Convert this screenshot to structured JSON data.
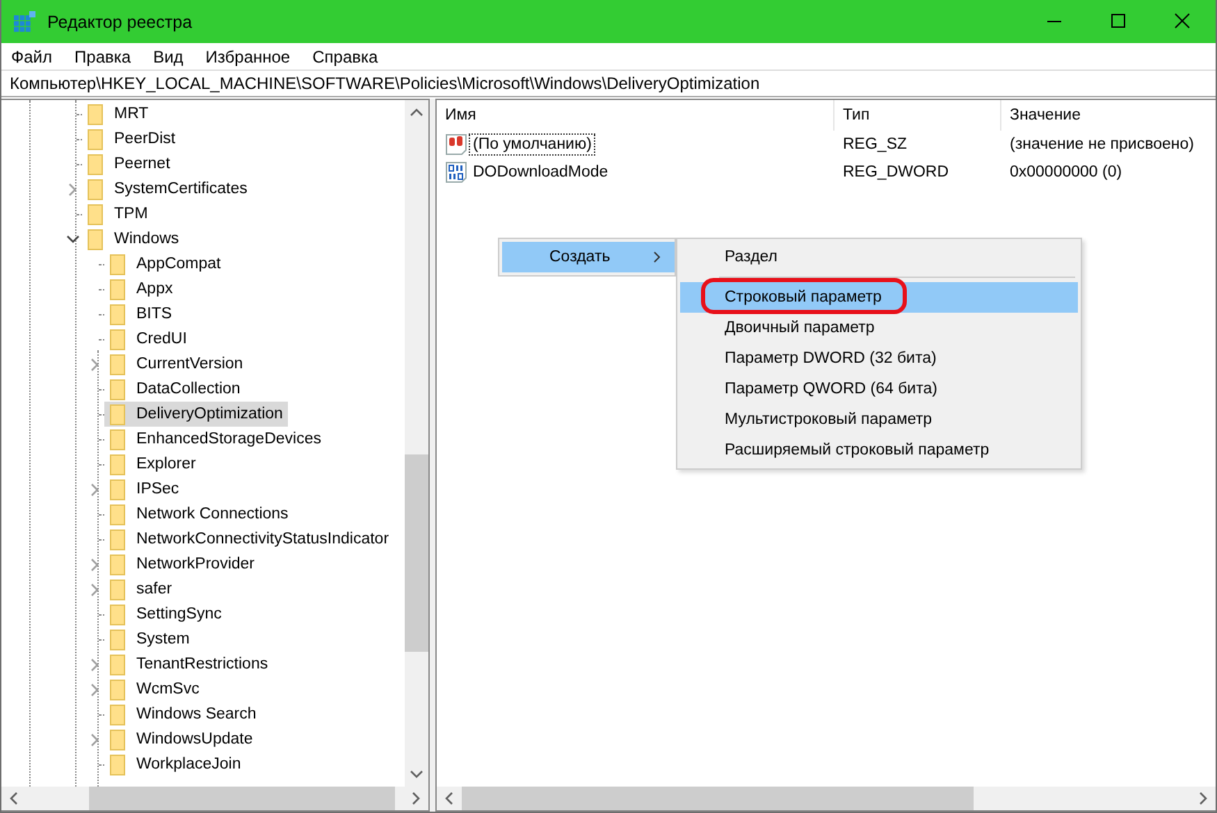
{
  "window": {
    "title": "Редактор реестра"
  },
  "menu": [
    "Файл",
    "Правка",
    "Вид",
    "Избранное",
    "Справка"
  ],
  "address": "Компьютер\\HKEY_LOCAL_MACHINE\\SOFTWARE\\Policies\\Microsoft\\Windows\\DeliveryOptimization",
  "tree": [
    {
      "label": "MRT",
      "kind": "leaf",
      "selected": false
    },
    {
      "label": "PeerDist",
      "kind": "leaf",
      "selected": false
    },
    {
      "label": "Peernet",
      "kind": "leaf",
      "selected": false
    },
    {
      "label": "SystemCertificates",
      "kind": "closed",
      "selected": false
    },
    {
      "label": "TPM",
      "kind": "leaf",
      "selected": false
    },
    {
      "label": "Windows",
      "kind": "open",
      "selected": false,
      "children": [
        {
          "label": "AppCompat",
          "kind": "leaf",
          "selected": false
        },
        {
          "label": "Appx",
          "kind": "leaf",
          "selected": false
        },
        {
          "label": "BITS",
          "kind": "leaf",
          "selected": false
        },
        {
          "label": "CredUI",
          "kind": "leaf",
          "selected": false
        },
        {
          "label": "CurrentVersion",
          "kind": "closed",
          "selected": false
        },
        {
          "label": "DataCollection",
          "kind": "leaf",
          "selected": false
        },
        {
          "label": "DeliveryOptimization",
          "kind": "leaf",
          "selected": true
        },
        {
          "label": "EnhancedStorageDevices",
          "kind": "leaf",
          "selected": false
        },
        {
          "label": "Explorer",
          "kind": "leaf",
          "selected": false
        },
        {
          "label": "IPSec",
          "kind": "closed",
          "selected": false
        },
        {
          "label": "Network Connections",
          "kind": "leaf",
          "selected": false
        },
        {
          "label": "NetworkConnectivityStatusIndicator",
          "kind": "leaf",
          "selected": false
        },
        {
          "label": "NetworkProvider",
          "kind": "closed",
          "selected": false
        },
        {
          "label": "safer",
          "kind": "closed",
          "selected": false
        },
        {
          "label": "SettingSync",
          "kind": "leaf",
          "selected": false
        },
        {
          "label": "System",
          "kind": "leaf",
          "selected": false
        },
        {
          "label": "TenantRestrictions",
          "kind": "closed",
          "selected": false
        },
        {
          "label": "WcmSvc",
          "kind": "closed",
          "selected": false
        },
        {
          "label": "Windows Search",
          "kind": "leaf",
          "selected": false
        },
        {
          "label": "WindowsUpdate",
          "kind": "closed",
          "selected": false
        },
        {
          "label": "WorkplaceJoin",
          "kind": "leaf",
          "selected": false
        }
      ]
    }
  ],
  "table": {
    "columns": [
      "Имя",
      "Тип",
      "Значение"
    ],
    "rows": [
      {
        "kind": "string",
        "focused": true,
        "name": "(По умолчанию)",
        "type": "REG_SZ",
        "value": "(значение не присвоено)"
      },
      {
        "kind": "binary",
        "focused": false,
        "name": "DODownloadMode",
        "type": "REG_DWORD",
        "value": "0x00000000 (0)"
      }
    ]
  },
  "context_menu": {
    "items": [
      {
        "label": "Создать",
        "selected": true,
        "submenu": true
      }
    ],
    "submenu": [
      {
        "kind": "item",
        "label": "Раздел",
        "selected": false,
        "circled": false
      },
      {
        "kind": "separator"
      },
      {
        "kind": "item",
        "label": "Строковый параметр",
        "selected": true,
        "circled": true
      },
      {
        "kind": "item",
        "label": "Двоичный параметр",
        "selected": false,
        "circled": false
      },
      {
        "kind": "item",
        "label": "Параметр DWORD (32 бита)",
        "selected": false,
        "circled": false
      },
      {
        "kind": "item",
        "label": "Параметр QWORD (64 бита)",
        "selected": false,
        "circled": false
      },
      {
        "kind": "item",
        "label": "Мультистроковый параметр",
        "selected": false,
        "circled": false
      },
      {
        "kind": "item",
        "label": "Расширяемый строковый параметр",
        "selected": false,
        "circled": false
      }
    ]
  }
}
